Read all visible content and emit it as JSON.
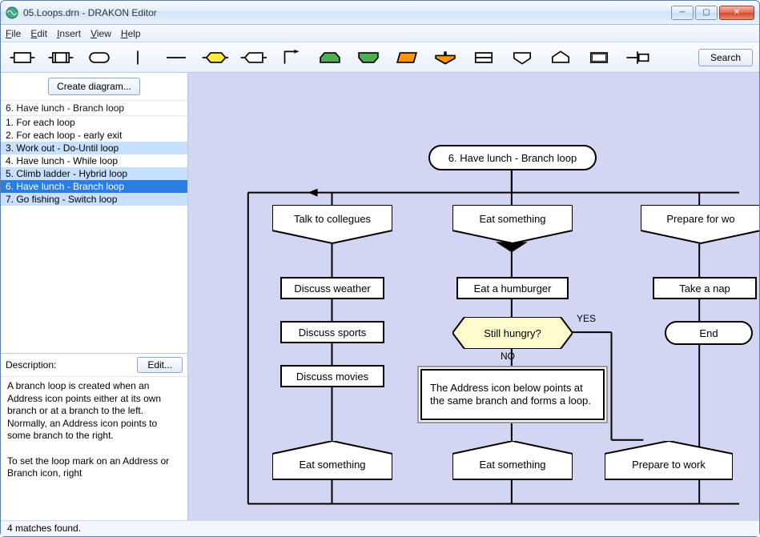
{
  "window": {
    "title": "05.Loops.drn - DRAKON Editor"
  },
  "menu": {
    "file": "File",
    "edit": "Edit",
    "insert": "Insert",
    "view": "View",
    "help": "Help"
  },
  "toolbar": {
    "search_label": "Search"
  },
  "sidebar": {
    "create_label": "Create diagram...",
    "current": "6. Have lunch - Branch loop",
    "items": [
      {
        "label": "1. For each loop"
      },
      {
        "label": "2. For each loop - early exit"
      },
      {
        "label": "3. Work out - Do-Until loop"
      },
      {
        "label": "4. Have lunch - While loop"
      },
      {
        "label": "5. Climb ladder - Hybrid loop"
      },
      {
        "label": "6. Have lunch - Branch loop"
      },
      {
        "label": "7. Go fishing - Switch loop"
      }
    ],
    "desc_label": "Description:",
    "edit_label": "Edit...",
    "description": "A branch loop is created when an Address icon points either at its own branch or at a branch to the left. Normally, an Address icon points to some branch to the right.\n\nTo set the loop mark on an Address or Branch icon, right"
  },
  "canvas": {
    "title": "6. Have lunch - Branch loop",
    "branch1": "Talk to collegues",
    "a1": "Discuss weather",
    "a2": "Discuss sports",
    "a3": "Discuss movies",
    "addr1": "Eat something",
    "branch2": "Eat something",
    "a4": "Eat a humburger",
    "q1": "Still hungry?",
    "yes": "YES",
    "no": "NO",
    "comment": "The Address icon below points at the same branch and forms a loop.",
    "addr2": "Eat something",
    "branch3": "Prepare for wo",
    "a5": "Take a nap",
    "end": "End",
    "addr3": "Prepare to work"
  },
  "status": {
    "text": "4 matches found."
  }
}
